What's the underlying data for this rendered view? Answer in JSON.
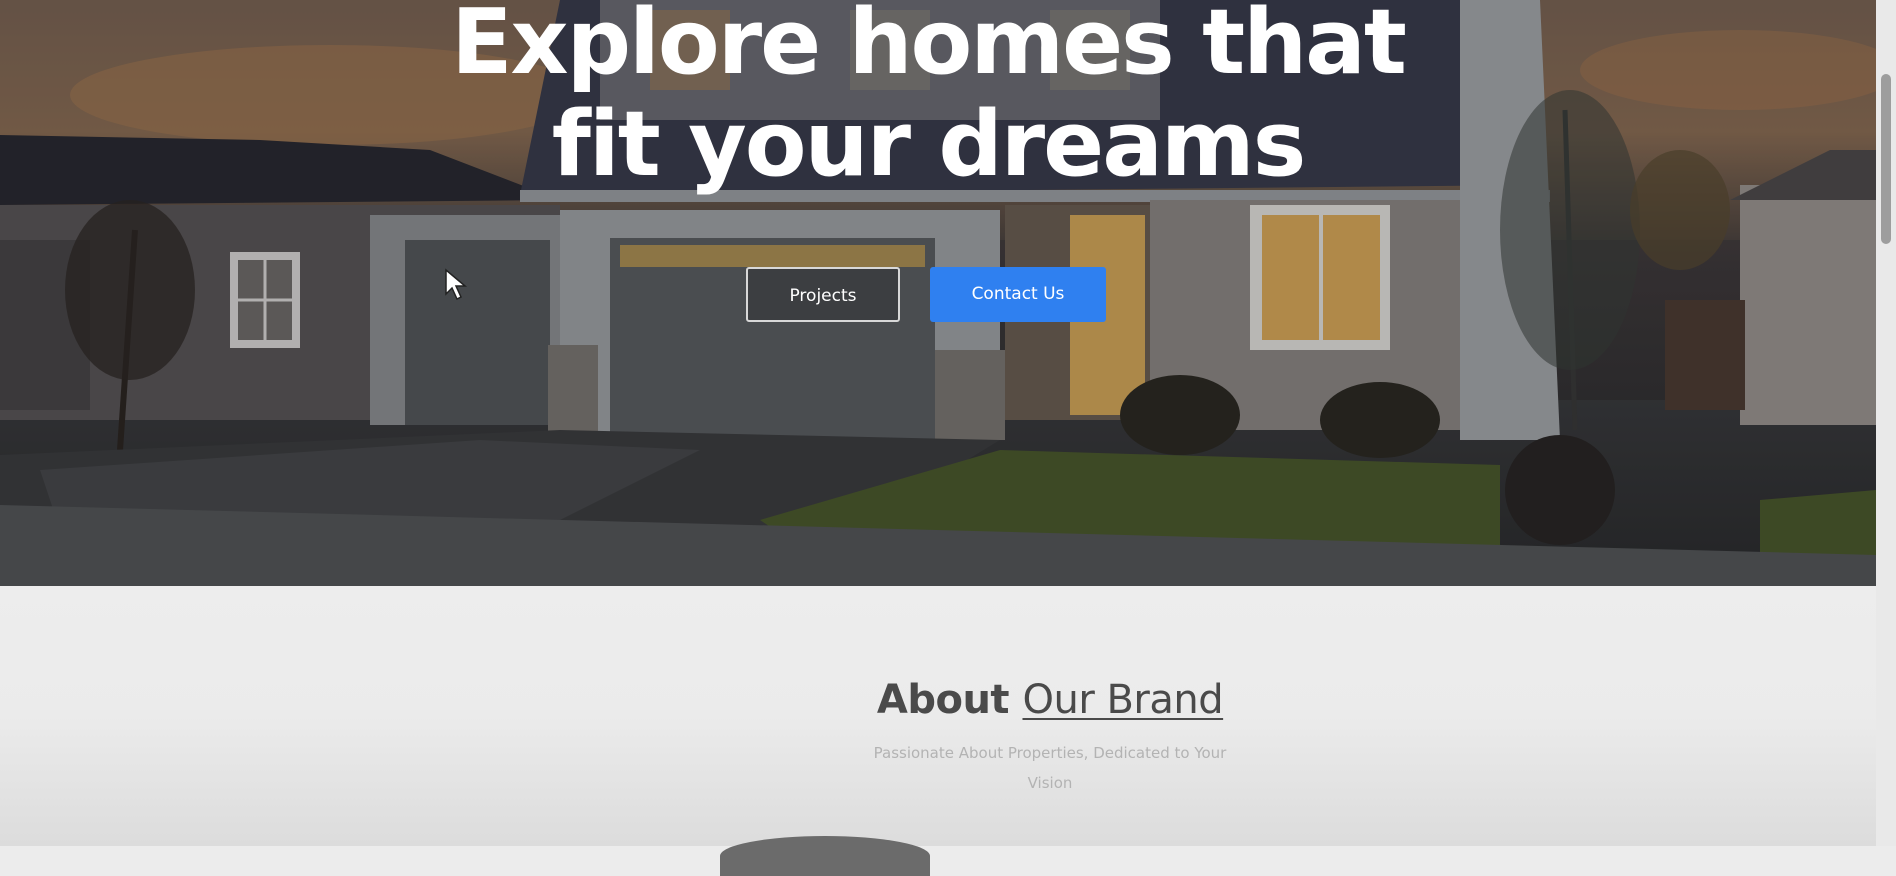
{
  "hero": {
    "title_line1": "Explore homes that",
    "title_line2": "fit your dreams",
    "projects_label": "Projects",
    "contact_label": "Contact Us"
  },
  "about": {
    "title_strong": "About",
    "title_light": "Our Brand",
    "subtitle": "Passionate About Properties, Dedicated to Your Vision"
  },
  "colors": {
    "accent": "#2f80f0",
    "hero_text": "#ffffff",
    "about_title": "#4a4a4a",
    "about_subtitle": "#b3b3b3"
  },
  "icons": {
    "cursor": "mouse-pointer-icon"
  }
}
